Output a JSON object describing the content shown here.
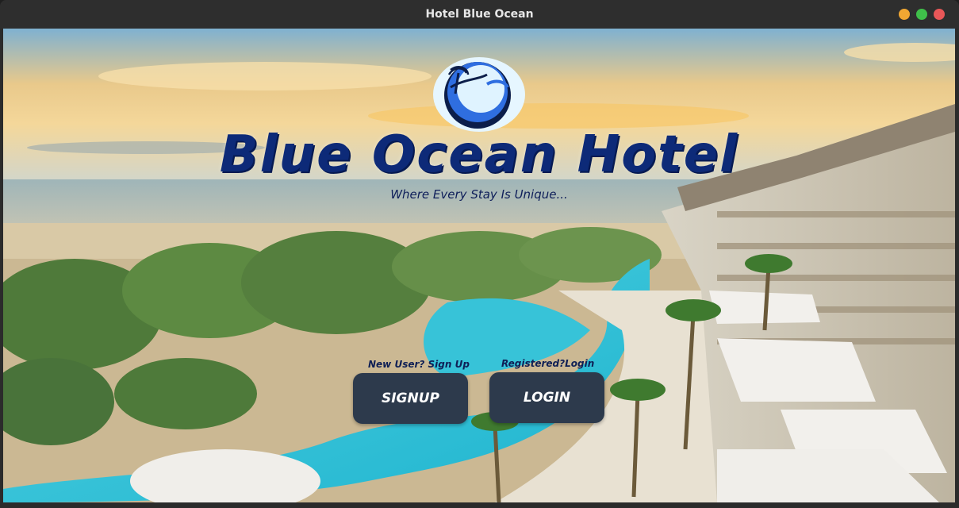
{
  "window": {
    "title": "Hotel Blue Ocean"
  },
  "hero": {
    "brand": "Blue Ocean Hotel",
    "tagline": "Where Every Stay Is Unique..."
  },
  "actions": {
    "signup_hint": "New User? Sign Up",
    "signup_label": "SIGNUP",
    "login_hint": "Registered?Login",
    "login_label": "LOGIN"
  },
  "colors": {
    "button_bg": "#2d3a4c",
    "brand_blue": "#0d2a78"
  }
}
